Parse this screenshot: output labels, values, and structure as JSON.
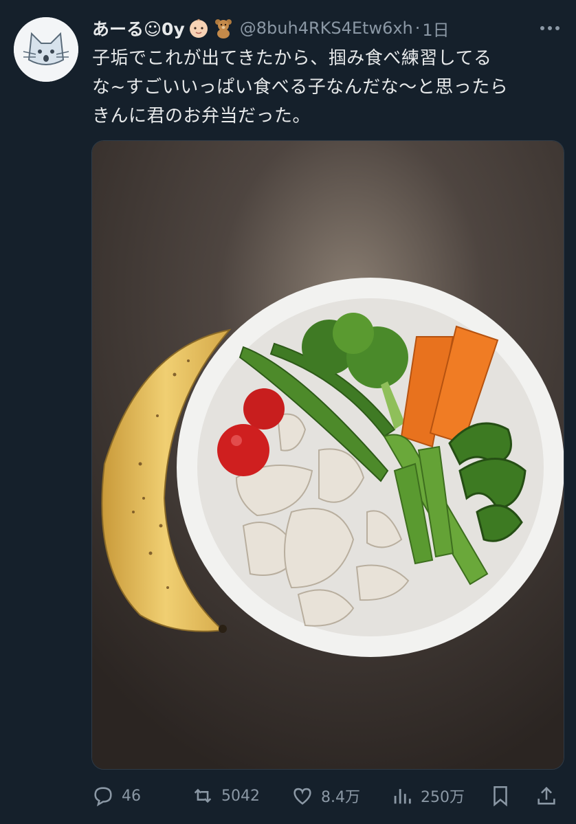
{
  "tweet": {
    "display_name": "あーる☺0y",
    "handle": "@8buh4RKS4Etw6xh",
    "separator": "·",
    "time": "1日",
    "text_lines": [
      "子垢でこれが出てきたから、掴み食べ練習してる",
      "な~すごいいっぱい食べる子なんだな〜と思ったら",
      "きんに君のお弁当だった。"
    ]
  },
  "actions": {
    "replies": "46",
    "retweets": "5042",
    "likes": "8.4万",
    "views": "250万"
  },
  "icons": {
    "avatar": "cat-avatar-icon",
    "emoji1": "baby-face-emoji",
    "emoji2": "teddy-bear-emoji",
    "more": "more-dots-icon",
    "reply": "speech-bubble-icon",
    "retweet": "retweet-arrows-icon",
    "like": "heart-icon",
    "views": "bar-chart-icon",
    "bookmark": "bookmark-icon",
    "share": "share-upload-icon"
  },
  "colors": {
    "background": "#15202b",
    "text": "#e7e9ea",
    "muted": "#8b98a5"
  }
}
